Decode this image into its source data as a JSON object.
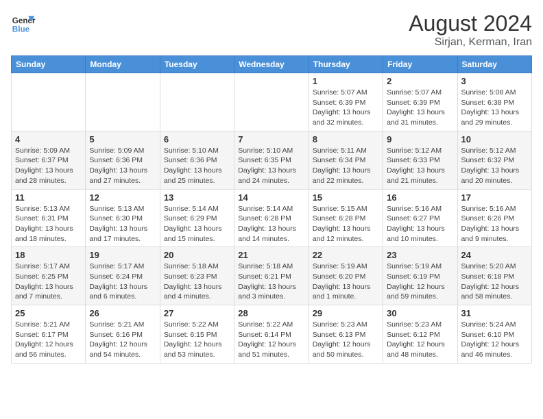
{
  "header": {
    "logo_general": "General",
    "logo_blue": "Blue",
    "month_year": "August 2024",
    "location": "Sirjan, Kerman, Iran"
  },
  "days_of_week": [
    "Sunday",
    "Monday",
    "Tuesday",
    "Wednesday",
    "Thursday",
    "Friday",
    "Saturday"
  ],
  "weeks": [
    [
      {
        "day": "",
        "info": ""
      },
      {
        "day": "",
        "info": ""
      },
      {
        "day": "",
        "info": ""
      },
      {
        "day": "",
        "info": ""
      },
      {
        "day": "1",
        "info": "Sunrise: 5:07 AM\nSunset: 6:39 PM\nDaylight: 13 hours\nand 32 minutes."
      },
      {
        "day": "2",
        "info": "Sunrise: 5:07 AM\nSunset: 6:39 PM\nDaylight: 13 hours\nand 31 minutes."
      },
      {
        "day": "3",
        "info": "Sunrise: 5:08 AM\nSunset: 6:38 PM\nDaylight: 13 hours\nand 29 minutes."
      }
    ],
    [
      {
        "day": "4",
        "info": "Sunrise: 5:09 AM\nSunset: 6:37 PM\nDaylight: 13 hours\nand 28 minutes."
      },
      {
        "day": "5",
        "info": "Sunrise: 5:09 AM\nSunset: 6:36 PM\nDaylight: 13 hours\nand 27 minutes."
      },
      {
        "day": "6",
        "info": "Sunrise: 5:10 AM\nSunset: 6:36 PM\nDaylight: 13 hours\nand 25 minutes."
      },
      {
        "day": "7",
        "info": "Sunrise: 5:10 AM\nSunset: 6:35 PM\nDaylight: 13 hours\nand 24 minutes."
      },
      {
        "day": "8",
        "info": "Sunrise: 5:11 AM\nSunset: 6:34 PM\nDaylight: 13 hours\nand 22 minutes."
      },
      {
        "day": "9",
        "info": "Sunrise: 5:12 AM\nSunset: 6:33 PM\nDaylight: 13 hours\nand 21 minutes."
      },
      {
        "day": "10",
        "info": "Sunrise: 5:12 AM\nSunset: 6:32 PM\nDaylight: 13 hours\nand 20 minutes."
      }
    ],
    [
      {
        "day": "11",
        "info": "Sunrise: 5:13 AM\nSunset: 6:31 PM\nDaylight: 13 hours\nand 18 minutes."
      },
      {
        "day": "12",
        "info": "Sunrise: 5:13 AM\nSunset: 6:30 PM\nDaylight: 13 hours\nand 17 minutes."
      },
      {
        "day": "13",
        "info": "Sunrise: 5:14 AM\nSunset: 6:29 PM\nDaylight: 13 hours\nand 15 minutes."
      },
      {
        "day": "14",
        "info": "Sunrise: 5:14 AM\nSunset: 6:28 PM\nDaylight: 13 hours\nand 14 minutes."
      },
      {
        "day": "15",
        "info": "Sunrise: 5:15 AM\nSunset: 6:28 PM\nDaylight: 13 hours\nand 12 minutes."
      },
      {
        "day": "16",
        "info": "Sunrise: 5:16 AM\nSunset: 6:27 PM\nDaylight: 13 hours\nand 10 minutes."
      },
      {
        "day": "17",
        "info": "Sunrise: 5:16 AM\nSunset: 6:26 PM\nDaylight: 13 hours\nand 9 minutes."
      }
    ],
    [
      {
        "day": "18",
        "info": "Sunrise: 5:17 AM\nSunset: 6:25 PM\nDaylight: 13 hours\nand 7 minutes."
      },
      {
        "day": "19",
        "info": "Sunrise: 5:17 AM\nSunset: 6:24 PM\nDaylight: 13 hours\nand 6 minutes."
      },
      {
        "day": "20",
        "info": "Sunrise: 5:18 AM\nSunset: 6:23 PM\nDaylight: 13 hours\nand 4 minutes."
      },
      {
        "day": "21",
        "info": "Sunrise: 5:18 AM\nSunset: 6:21 PM\nDaylight: 13 hours\nand 3 minutes."
      },
      {
        "day": "22",
        "info": "Sunrise: 5:19 AM\nSunset: 6:20 PM\nDaylight: 13 hours\nand 1 minute."
      },
      {
        "day": "23",
        "info": "Sunrise: 5:19 AM\nSunset: 6:19 PM\nDaylight: 12 hours\nand 59 minutes."
      },
      {
        "day": "24",
        "info": "Sunrise: 5:20 AM\nSunset: 6:18 PM\nDaylight: 12 hours\nand 58 minutes."
      }
    ],
    [
      {
        "day": "25",
        "info": "Sunrise: 5:21 AM\nSunset: 6:17 PM\nDaylight: 12 hours\nand 56 minutes."
      },
      {
        "day": "26",
        "info": "Sunrise: 5:21 AM\nSunset: 6:16 PM\nDaylight: 12 hours\nand 54 minutes."
      },
      {
        "day": "27",
        "info": "Sunrise: 5:22 AM\nSunset: 6:15 PM\nDaylight: 12 hours\nand 53 minutes."
      },
      {
        "day": "28",
        "info": "Sunrise: 5:22 AM\nSunset: 6:14 PM\nDaylight: 12 hours\nand 51 minutes."
      },
      {
        "day": "29",
        "info": "Sunrise: 5:23 AM\nSunset: 6:13 PM\nDaylight: 12 hours\nand 50 minutes."
      },
      {
        "day": "30",
        "info": "Sunrise: 5:23 AM\nSunset: 6:12 PM\nDaylight: 12 hours\nand 48 minutes."
      },
      {
        "day": "31",
        "info": "Sunrise: 5:24 AM\nSunset: 6:10 PM\nDaylight: 12 hours\nand 46 minutes."
      }
    ]
  ]
}
